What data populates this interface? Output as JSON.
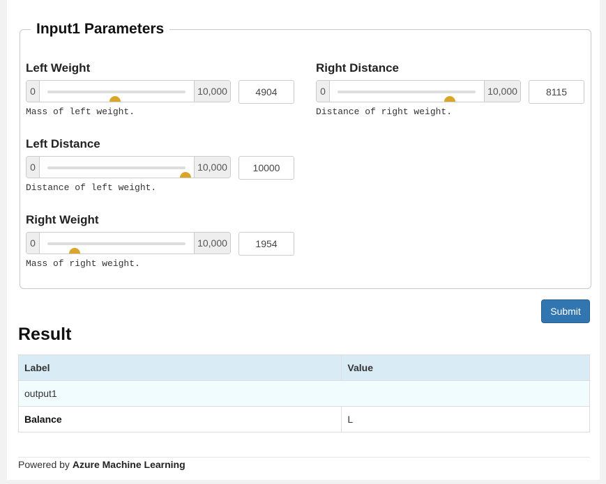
{
  "form": {
    "legend": "Input1 Parameters",
    "submit_label": "Submit",
    "params": [
      {
        "label": "Left Weight",
        "min_label": "0",
        "max_label": "10,000",
        "value": "4904",
        "fraction": 0.4904,
        "description": "Mass of left weight."
      },
      {
        "label": "Right Distance",
        "min_label": "0",
        "max_label": "10,000",
        "value": "8115",
        "fraction": 0.8115,
        "description": "Distance of right weight."
      },
      {
        "label": "Left Distance",
        "min_label": "0",
        "max_label": "10,000",
        "value": "10000",
        "fraction": 1.0,
        "description": "Distance of left weight."
      },
      {
        "label": "Right Weight",
        "min_label": "0",
        "max_label": "10,000",
        "value": "1954",
        "fraction": 0.1954,
        "description": "Mass of right weight."
      }
    ]
  },
  "result": {
    "title": "Result",
    "headers": [
      "Label",
      "Value"
    ],
    "group_label": "output1",
    "rows": [
      {
        "label": "Balance",
        "value": "L"
      }
    ]
  },
  "footer": {
    "prefix": "Powered by ",
    "brand": "Azure Machine Learning"
  },
  "colors": {
    "thumb": "#dba52a",
    "submit": "#3276b1",
    "table_header": "#d9ebf5"
  }
}
